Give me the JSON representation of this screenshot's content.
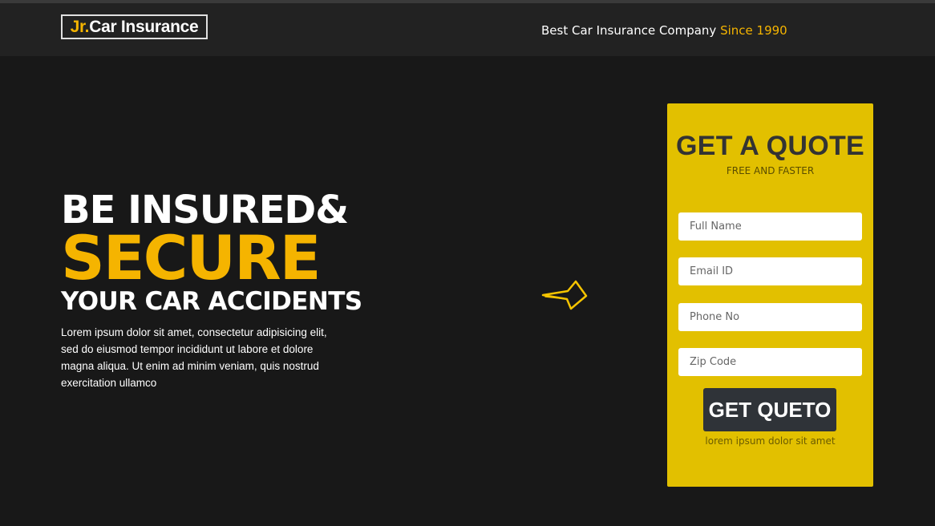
{
  "header": {
    "logo_prefix": "Jr.",
    "logo_name": "Car Insurance",
    "tagline_text": "Best Car Insurance Company",
    "tagline_highlight": "Since 1990"
  },
  "hero": {
    "line1": "BE INSURED&",
    "line2": "SECURE",
    "line3": "YOUR CAR ACCIDENTS",
    "description": "Lorem ipsum dolor sit amet, consectetur adipisicing elit, sed do eiusmod tempor incididunt ut labore et dolore magna aliqua. Ut enim ad minim veniam, quis nostrud exercitation ullamco"
  },
  "decor": {
    "arrow_icon": "hand-drawn-arrow-left-icon"
  },
  "quote_form": {
    "title": "GET A QUOTE",
    "subtitle": "FREE AND FASTER",
    "fields": {
      "full_name_placeholder": "Full Name",
      "email_placeholder": "Email ID",
      "phone_placeholder": "Phone No",
      "zip_placeholder": "Zip Code"
    },
    "submit_label": "GET QUETO",
    "note": "lorem ipsum dolor sit amet"
  },
  "colors": {
    "accent": "#f5b400",
    "background": "#181818",
    "header": "#222222",
    "form_panel": "#e2c000",
    "button": "#2f3338"
  }
}
